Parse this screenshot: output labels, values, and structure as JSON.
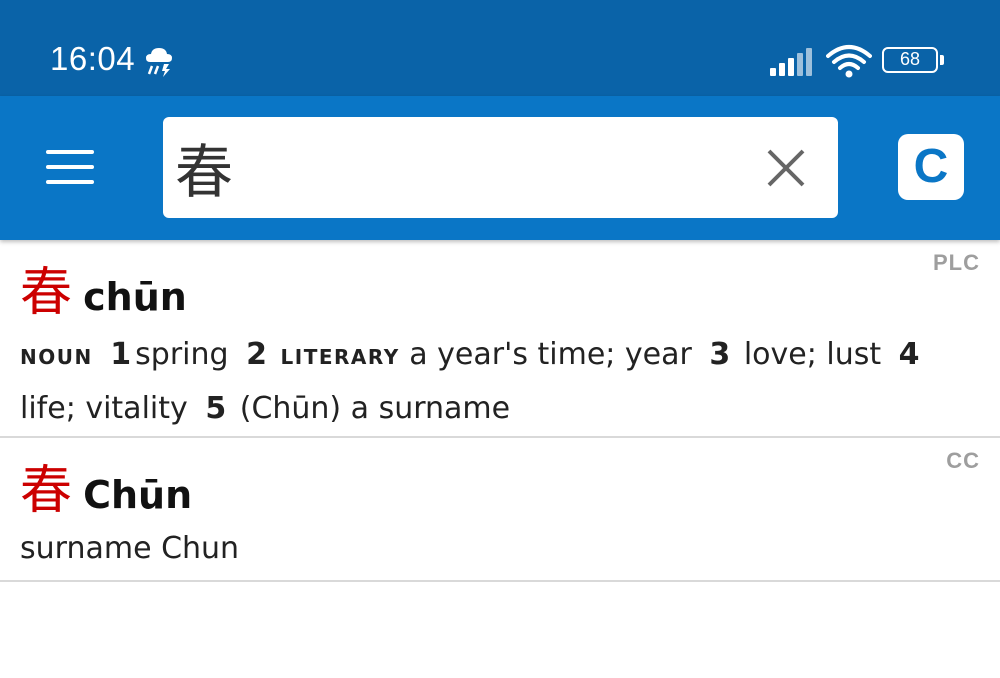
{
  "status_bar": {
    "time": "16:04",
    "weather_icon": "cloud-rain-icon",
    "battery": "68"
  },
  "app_bar": {
    "menu_icon": "hamburger-menu-icon",
    "search_value": "春",
    "clear_icon": "close-icon",
    "c_button_label": "C"
  },
  "entries": [
    {
      "source": "PLC",
      "hanzi": "春",
      "pinyin": "chūn",
      "senses": [
        {
          "pos": "noun",
          "num": "1",
          "text": "spring"
        },
        {
          "pos": "literary",
          "num": "2",
          "text": "a year's time; year"
        },
        {
          "num": "3",
          "text": "love; lust"
        },
        {
          "num": "4",
          "text": "life; vitality"
        },
        {
          "num": "5",
          "text": "(Chūn) a surname"
        }
      ]
    },
    {
      "source": "CC",
      "hanzi": "春",
      "pinyin": "Chūn",
      "definition": "surname Chun"
    }
  ],
  "colors": {
    "status_bar_bg": "#0a63a8",
    "app_bar_bg": "#0a76c6",
    "hanzi_red": "#cc0000",
    "tag_gray": "#9e9e9e"
  }
}
